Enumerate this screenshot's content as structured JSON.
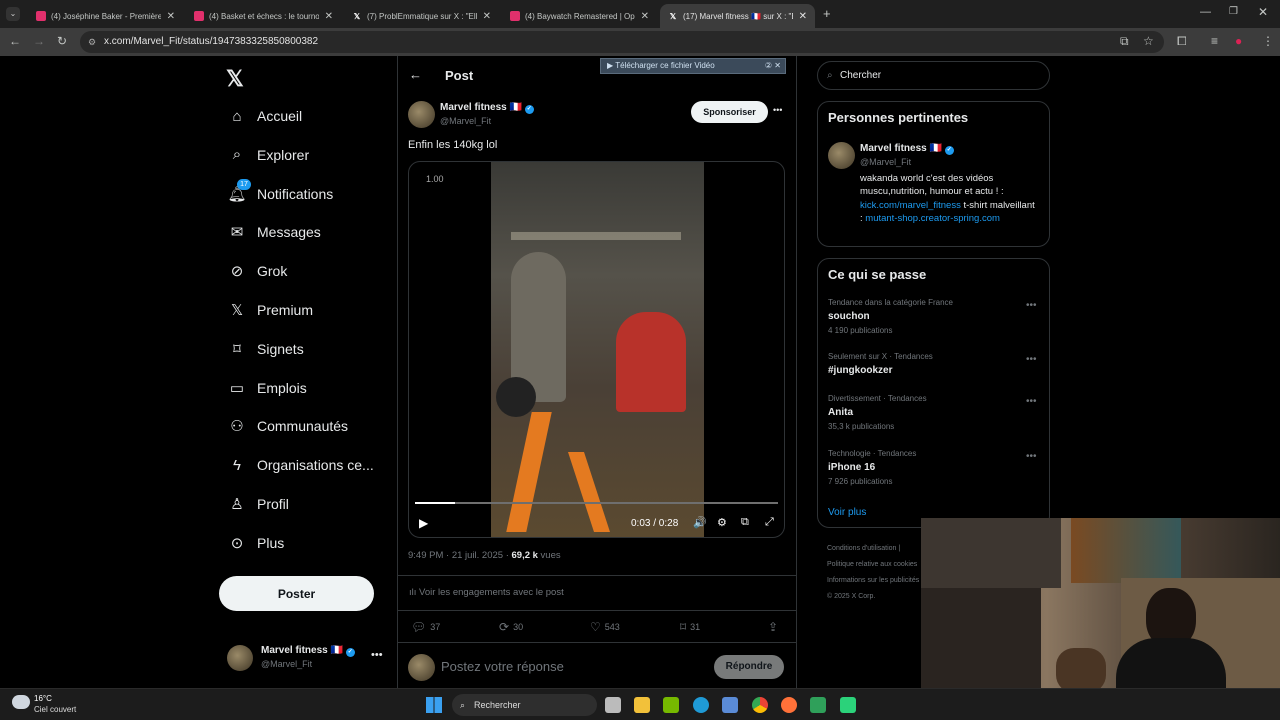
{
  "browser": {
    "tabs": [
      {
        "title": "(4) Joséphine Baker - Première",
        "favicon": "youtube-icon",
        "active": false
      },
      {
        "title": "(4) Basket et échecs : le tournoi",
        "favicon": "youtube-icon",
        "active": false
      },
      {
        "title": "(7) ProblEmmatique sur X : \"Elle",
        "favicon": "x-icon",
        "active": false
      },
      {
        "title": "(4) Baywatch Remastered | Ope",
        "favicon": "youtube-icon",
        "active": false
      },
      {
        "title": "(17) Marvel fitness 🇫🇷 sur X : \"Er",
        "favicon": "x-icon",
        "active": true
      }
    ],
    "url": "x.com/Marvel_Fit/status/1947383325850800382",
    "download_banner": "Télécharger ce fichier Vidéo"
  },
  "sidebar": {
    "items": [
      {
        "label": "Accueil",
        "icon": "home-icon"
      },
      {
        "label": "Explorer",
        "icon": "search-icon"
      },
      {
        "label": "Notifications",
        "icon": "bell-icon",
        "badge": "17"
      },
      {
        "label": "Messages",
        "icon": "mail-icon"
      },
      {
        "label": "Grok",
        "icon": "grok-icon"
      },
      {
        "label": "Premium",
        "icon": "x-logo-icon"
      },
      {
        "label": "Signets",
        "icon": "bookmark-icon"
      },
      {
        "label": "Emplois",
        "icon": "briefcase-icon"
      },
      {
        "label": "Communautés",
        "icon": "people-icon"
      },
      {
        "label": "Organisations ce...",
        "icon": "lightning-icon"
      },
      {
        "label": "Profil",
        "icon": "person-icon"
      },
      {
        "label": "Plus",
        "icon": "more-circle-icon"
      }
    ],
    "post_button": "Poster",
    "account": {
      "name": "Marvel fitness",
      "flag": "🇫🇷",
      "handle": "@Marvel_Fit"
    }
  },
  "post": {
    "header_title": "Post",
    "author_name": "Marvel fitness",
    "author_flag": "🇫🇷",
    "author_handle": "@Marvel_Fit",
    "sponsor_button": "Sponsoriser",
    "text": "Enfin les 140kg lol",
    "video": {
      "speed": "1.00",
      "time": "0:03 / 0:28",
      "progress": 0.11
    },
    "timestamp": "9:49 PM · 21 juil. 2025 · ",
    "views": "69,2 k",
    "views_label": " vues",
    "engagements_link": "Voir les engagements avec le post",
    "counts": {
      "replies": "37",
      "reposts": "30",
      "likes": "543",
      "bookmarks": "31"
    },
    "reply_placeholder": "Postez votre réponse",
    "reply_button": "Répondre"
  },
  "right": {
    "search_placeholder": "Chercher",
    "relevant_title": "Personnes pertinentes",
    "relevant": {
      "name": "Marvel fitness",
      "flag": "🇫🇷",
      "handle": "@Marvel_Fit",
      "bio_1": "wakanda world c'est des vidéos muscu,nutrition, humour et actu ! :",
      "bio_link_1": "kick.com/marvel_fitness",
      "bio_2": " t-shirt malveillant : ",
      "bio_link_2": "mutant-shop.creator-spring.com"
    },
    "happening_title": "Ce qui se passe",
    "trends": [
      {
        "category": "Tendance dans la catégorie France",
        "name": "souchon",
        "count": "4 190 publications"
      },
      {
        "category": "Seulement sur X · Tendances",
        "name": "#jungkookzer",
        "count": ""
      },
      {
        "category": "Divertissement · Tendances",
        "name": "Anita",
        "count": "35,3 k publications"
      },
      {
        "category": "Technologie · Tendances",
        "name": "iPhone 16",
        "count": "7 926 publications"
      }
    ],
    "see_more": "Voir plus",
    "footer": [
      "Conditions d'utilisation  |",
      "Politique relative aux cookies",
      "Informations sur les publicités",
      "© 2025 X Corp."
    ]
  },
  "taskbar": {
    "weather_temp": "16°C",
    "weather_desc": "Ciel couvert",
    "search_placeholder": "Rechercher"
  },
  "colors": {
    "accent": "#1d9bf0",
    "background": "#000000",
    "border": "#2f3336",
    "muted": "#71767b"
  }
}
